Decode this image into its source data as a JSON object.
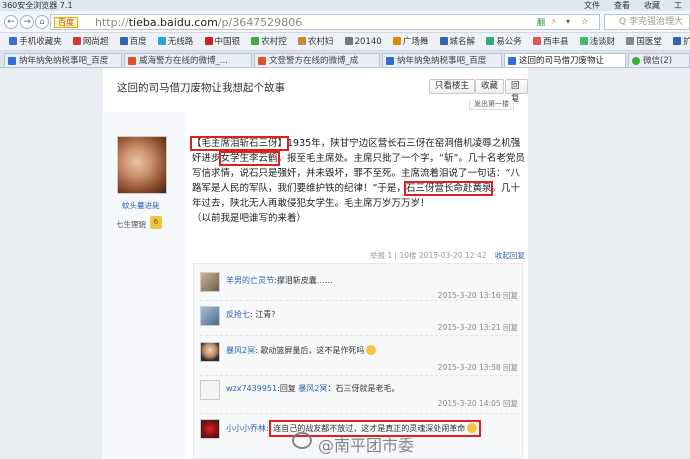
{
  "browser": {
    "title": "360安全浏览器 7.1",
    "menu": [
      "文件",
      "查看",
      "收藏",
      "工"
    ],
    "url_prefix": "http://",
    "url_domain": "tieba.baidu.com",
    "url_path": "/p/3647529806",
    "baidu_badge": "百度",
    "url_right_hint": "翻",
    "search_placeholder": "Q 李克强治理大"
  },
  "bookmarks": [
    {
      "label": "手机收藏夹",
      "color": "#3b6fd1"
    },
    {
      "label": "网尚超",
      "color": "#d33"
    },
    {
      "label": "百度",
      "color": "#2d64b3"
    },
    {
      "label": "无线路",
      "color": "#2aa3d8"
    },
    {
      "label": "中国银",
      "color": "#c22"
    },
    {
      "label": "农村控",
      "color": "#4a4"
    },
    {
      "label": "农村妇",
      "color": "#c83"
    },
    {
      "label": "20140",
      "color": "#777"
    },
    {
      "label": "广场舞",
      "color": "#e08a00"
    },
    {
      "label": "城名解",
      "color": "#2d64b3"
    },
    {
      "label": "易公务",
      "color": "#3a7"
    },
    {
      "label": "西丰县",
      "color": "#d55"
    },
    {
      "label": "浅谈财",
      "color": "#4b6"
    },
    {
      "label": "国医堂",
      "color": "#888"
    },
    {
      "label": "扩展",
      "color": "#2d64b3"
    }
  ],
  "tabs": [
    {
      "label": "纳年纳免纳税事吧_百度"
    },
    {
      "label": "威海警方在线的微博_..."
    },
    {
      "label": "文登警方在线的微博_成"
    },
    {
      "label": "纳年纳免纳税事吧_百度"
    },
    {
      "label": "这回的司马借刀废物让"
    },
    {
      "label": "微信(2)"
    }
  ],
  "thread": {
    "title": "这回的司马借刀废物让我想起个故事",
    "buttons": [
      "只看楼主",
      "收藏",
      "回复"
    ],
    "back_link": "发出第一楼"
  },
  "author": {
    "username": "蚊头蔓进毙",
    "level_label": "七生狸貌",
    "level": "6"
  },
  "post": {
    "hl_title": "【毛主席泪斩石三伢】",
    "p1_a": "1935年，陕甘宁边区营长石三伢在窑洞借机凌辱之机强奸进步",
    "hl_student": "女学生李云鹤",
    "p1_b": "，报至毛主席处。主席只批了一个字，“斩”。几十名老党员写信求情，说石只是强奸，并未毁坏，罪不至死。主席流着泪说了一句话：“八路军是人民的军队，我们要维护铁的纪律！”于是，",
    "hl_executed": "石三伢营长命赴黄泉",
    "p1_c": "。几十年过去，陕北无人再敢侵犯女学生。毛主席万岁万万岁！",
    "p2": "（以前我是吧谁写的来着）",
    "tail_report": "举报",
    "tail_floor": "1 | 10楼",
    "tail_date": "2015-03-20 12:42",
    "tail_reply": "收起回复"
  },
  "comments": [
    {
      "user": "羊男的亡灵节",
      "text": "撑泪斩皮囊……",
      "time": "",
      "reply": ""
    },
    {
      "user": "",
      "text": "",
      "time": "2015-3-20 13:16",
      "reply": "回复"
    },
    {
      "user": "反抢七",
      "text": "江青？",
      "time": "2015-3-20 13:21",
      "reply": "回复"
    },
    {
      "user": "暴风2冥",
      "text": "歌动篮屏量后，这不是作死吗",
      "time": "2015-3-20 13:58",
      "reply": "回复"
    },
    {
      "user": "wzx7439951",
      "text": "回复 ",
      "reply_to": "暴风2冥",
      "tail": "：石三伢就是老毛。",
      "time": "2015-3-20 14:05",
      "reply": "回复"
    },
    {
      "user": "小小小乔林",
      "text": "连自己的战友都不放过，这才是真正的灵魂深处闹革命",
      "time": "",
      "reply": ""
    }
  ],
  "watermark": "@南平团市委"
}
